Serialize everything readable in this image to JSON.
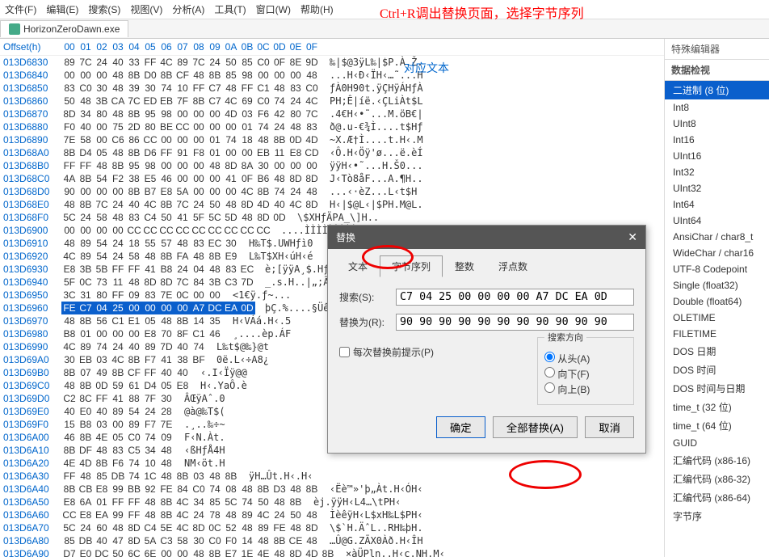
{
  "menu": [
    "文件(F)",
    "编辑(E)",
    "搜索(S)",
    "视图(V)",
    "分析(A)",
    "工具(T)",
    "窗口(W)",
    "帮助(H)"
  ],
  "tab_title": "HorizonZeroDawn.exe",
  "annotation": "Ctrl+R调出替换页面，选择字节序列",
  "ascii_header": "对应文本",
  "offset_label": "Offset(h)",
  "hex_cols": [
    "00",
    "01",
    "02",
    "03",
    "04",
    "05",
    "06",
    "07",
    "08",
    "09",
    "0A",
    "0B",
    "0C",
    "0D",
    "0E",
    "0F"
  ],
  "rows": [
    {
      "o": "013D6830",
      "b": "89 7C 24 40 33 FF 4C 89 7C 24 50 85 C0 0F 8E 9D",
      "a": "‰|$@3ÿL‰|$P.À.Ž."
    },
    {
      "o": "013D6840",
      "b": "00 00 00 48 8B D0 8B CF 48 8B 85 98 00 00 00 48",
      "a": "...H‹Ð‹ÏH‹…˜...H"
    },
    {
      "o": "013D6850",
      "b": "83 C0 30 48 39 30 74 10 FF C7 48 FF C1 48 83 C0",
      "a": "ƒÀ0H90t.ÿÇHÿÁHƒÀ"
    },
    {
      "o": "013D6860",
      "b": "50 48 3B CA 7C ED EB 7F 8B C7 4C 69 C0 74 24 4C",
      "a": "PH;Ê|íë.‹ÇLiÀt$L"
    },
    {
      "o": "013D6870",
      "b": "8D 34 80 48 8B 95 98 00 00 00 4D 03 F6 42 80 7C",
      "a": ".4€H‹•˜...M.öB€|"
    },
    {
      "o": "013D6880",
      "b": "F0 40 00 75 2D 80 BE CC 00 00 00 01 74 24 48 83",
      "a": "ð@.u-€¾Ì....t$Hƒ"
    },
    {
      "o": "013D6890",
      "b": "7E 58 00 C6 86 CC 00 00 00 01 74 18 48 8B 0D 4D",
      "a": "~X.Æ†Ì....t.H‹.M"
    },
    {
      "o": "013D68A0",
      "b": "8B D4 05 48 8B D6 FF 91 F8 01 00 00 EB 11 E8 CD",
      "a": "‹Ô.H‹Öÿ'ø...ë.èÍ"
    },
    {
      "o": "013D68B0",
      "b": "FF FF 48 8B 95 98 00 00 00 48 8D 8A 30 00 00 00",
      "a": "ÿÿH‹•˜...H.Š0..."
    },
    {
      "o": "013D68C0",
      "b": "4A 8B 54 F2 38 E5 46 00 00 00 41 0F B6 48 8D 8D",
      "a": "J‹Tò8åF...A.¶H.."
    },
    {
      "o": "013D68D0",
      "b": "90 00 00 00 8B B7 E8 5A 00 00 00 4C 8B 74 24 48",
      "a": "...‹·èZ...L‹t$H"
    },
    {
      "o": "013D68E0",
      "b": "48 8B 7C 24 40 4C 8B 7C 24 50 48 8D 4D 40 4C 8D",
      "a": "H‹|$@L‹|$PH.M@L."
    },
    {
      "o": "013D68F0",
      "b": "5C 24 58 48 83 C4 50 41 5F 5C 5D 48 8D 0D",
      "a": "\\$XHƒÄPA_\\]H.."
    },
    {
      "o": "013D6900",
      "b": "00 00 00 00 CC CC CC CC CC CC CC CC CC",
      "a": "....ÌÌÌÌÌÌÌÌÌ"
    },
    {
      "o": "013D6910",
      "b": "48 89 54 24 18 55 57 48 83 EC 30",
      "a": "H‰T$.UWHƒì0"
    },
    {
      "o": "013D6920",
      "b": "4C 89 54 24 58 48 8B FA 48 8B E9",
      "a": "L‰T$XH‹úH‹é"
    },
    {
      "o": "013D6930",
      "b": "E8 3B 5B FF FF 41 B8 24 04 48 83 EC",
      "a": "è;[ÿÿA¸$.Hƒì"
    },
    {
      "o": "013D6940",
      "b": "5F 0C 73 11 48 8D 8D 7C 84 3B C3 7D",
      "a": "_.s.H..|„;Ã}"
    },
    {
      "o": "013D6950",
      "b": "3C 31 80 FF 09 83 7E 0C 00 00",
      "a": "<1€ÿ.ƒ~..."
    },
    {
      "o": "013D6960",
      "b": "FE C7 04 25 00 00 00 00 A7 DC EA 0D",
      "a": "þÇ.%....§Üê.",
      "sel": true
    },
    {
      "o": "013D6970",
      "b": "48 8B 56 C1 E1 05 48 8B 14 35",
      "a": "H‹VÁá.H‹.5"
    },
    {
      "o": "013D6980",
      "b": "B8 01 00 00 00 E8 70 8F C1 46",
      "a": "¸....èp.ÁF"
    },
    {
      "o": "013D6990",
      "b": "4C 89 74 24 40 89 7D 40 74",
      "a": "L‰t$@‰}@t"
    },
    {
      "o": "013D69A0",
      "b": "30 EB 03 4C 8B F7 41 38 BF",
      "a": "0ë.L‹÷A8¿"
    },
    {
      "o": "013D69B0",
      "b": "8B 07 49 8B CF FF 40 40",
      "a": "‹.I‹Ïÿ@@"
    },
    {
      "o": "013D69C0",
      "b": "48 8B 0D 59 61 D4 05 E8",
      "a": "H‹.YaÔ.è"
    },
    {
      "o": "013D69D0",
      "b": "C2 8C FF 41 88 7F 30",
      "a": "ÂŒÿAˆ.0"
    },
    {
      "o": "013D69E0",
      "b": "40 E0 40 89 54 24 28",
      "a": "@à@‰T$("
    },
    {
      "o": "013D69F0",
      "b": "15 B8 03 00 89 F7 7E",
      "a": ".¸..‰÷~"
    },
    {
      "o": "013D6A00",
      "b": "46 8B 4E 05 C0 74 09",
      "a": "F‹N.Àt."
    },
    {
      "o": "013D6A10",
      "b": "8B DF 48 83 C5 34 48",
      "a": "‹ßHƒÅ4H"
    },
    {
      "o": "013D6A20",
      "b": "4E 4D 8B F6 74 10 48",
      "a": "NM‹öt.H"
    },
    {
      "o": "013D6A30",
      "b": "FF 48 85 DB 74 1C 48 8B 03 48 8B",
      "a": "ÿH…Ût.H‹.H‹"
    },
    {
      "o": "013D6A40",
      "b": "8B CB E8 99 BB 92 FE 84 C0 74 08 48 8B D3 48 8B",
      "a": "‹Ëè™»'þ„Àt.H‹ÓH‹"
    },
    {
      "o": "013D6A50",
      "b": "E8 6A 01 FF FF 48 8B 4C 34 85 5C 74 50 48 8B",
      "a": "èj.ÿÿH‹L4…\\tPH‹"
    },
    {
      "o": "013D6A60",
      "b": "CC E8 EA 99 FF 48 8B 4C 24 78 48 89 4C 24 50 48",
      "a": "ÌèêÿH‹L$xH‰L$PH‹"
    },
    {
      "o": "013D6A70",
      "b": "5C 24 60 48 8D C4 5E 4C 8D 0C 52 48 89 FE 48 8D",
      "a": "\\$`H.ÄˆL..RH‰þH."
    },
    {
      "o": "013D6A80",
      "b": "85 DB 40 47 8D 5A C3 58 30 C0 F0 14 48 8B CE 48",
      "a": "…Û@G.ZÃX0Àð.H‹ÎH"
    },
    {
      "o": "013D6A90",
      "b": "D7 E0 DC 50 6C 6E 00 00 48 8B E7 1E 4E 48 8D 4D 8B",
      "a": "×àÜPln..H‹ç.NH.M‹"
    }
  ],
  "right": {
    "header": "特殊编辑器",
    "sub": "数据检视",
    "items": [
      "二进制 (8 位)",
      "Int8",
      "UInt8",
      "Int16",
      "UInt16",
      "Int32",
      "UInt32",
      "Int64",
      "UInt64",
      "AnsiChar / char8_t",
      "WideChar / char16",
      "UTF-8 Codepoint",
      "Single (float32)",
      "Double (float64)",
      "OLETIME",
      "FILETIME",
      "DOS 日期",
      "DOS 时间",
      "DOS 时间与日期",
      "time_t (32 位)",
      "time_t (64 位)",
      "GUID",
      "汇编代码 (x86-16)",
      "汇编代码 (x86-32)",
      "汇编代码 (x86-64)",
      "字节序"
    ]
  },
  "dialog": {
    "title": "替换",
    "tabs": [
      "文本",
      "字节序列",
      "整数",
      "浮点数"
    ],
    "active_tab": 1,
    "search_label": "搜索(S):",
    "search_value": "C7 04 25 00 00 00 00 A7 DC EA 0D",
    "replace_label": "替换为(R):",
    "replace_value": "90 90 90 90 90 90 90 90 90 90 90",
    "prompt_label": "每次替换前提示(P)",
    "dir_label": "搜索方向",
    "dir_opts": [
      "从头(A)",
      "向下(F)",
      "向上(B)"
    ],
    "btns": [
      "确定",
      "全部替换(A)",
      "取消"
    ]
  }
}
